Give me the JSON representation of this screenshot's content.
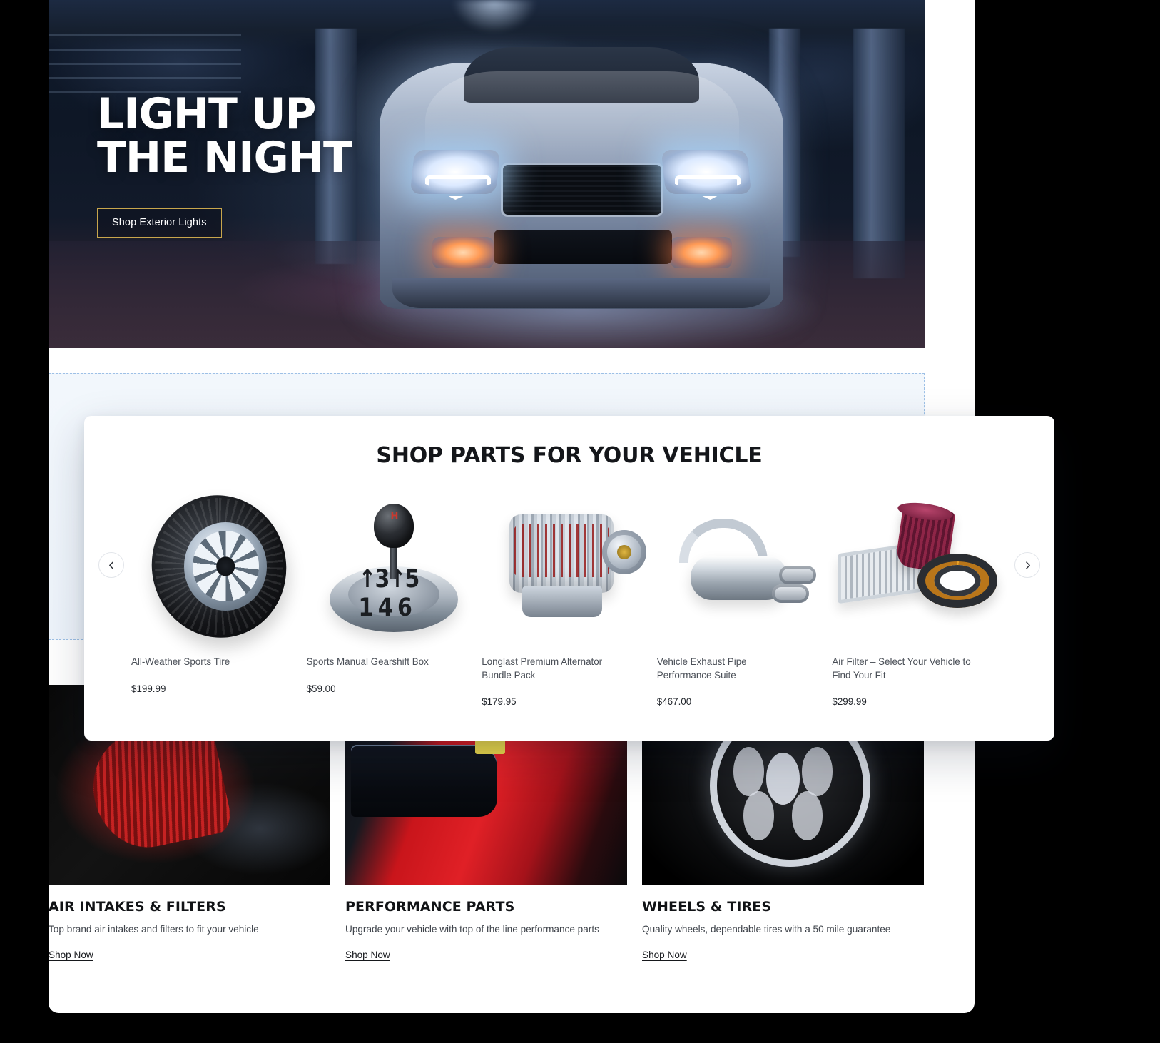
{
  "hero": {
    "title": "LIGHT UP\nTHE NIGHT",
    "cta_label": "Shop Exterior Lights",
    "cta_border_color": "#c8a64c"
  },
  "carousel_panel": {
    "title": "SHOP PARTS FOR YOUR VEHICLE",
    "prev_label": "‹",
    "next_label": "›",
    "products": [
      {
        "name": "All-Weather Sports Tire",
        "price": "$199.99",
        "image": "tire-image"
      },
      {
        "name": "Sports Manual Gearshift Box",
        "price": "$59.00",
        "image": "gearshift-image"
      },
      {
        "name": "Longlast Premium Alternator Bundle Pack",
        "price": "$179.95",
        "image": "alternator-image"
      },
      {
        "name": "Vehicle Exhaust Pipe Performance Suite",
        "price": "$467.00",
        "image": "exhaust-image"
      },
      {
        "name": "Air Filter – Select Your Vehicle to Find Your Fit",
        "price": "$299.99",
        "image": "air-filter-image"
      }
    ]
  },
  "categories": [
    {
      "title": "AIR INTAKES & FILTERS",
      "description": "Top brand air intakes and filters to fit your vehicle",
      "link_label": "Shop Now",
      "image": "air-intake-photo"
    },
    {
      "title": "PERFORMANCE PARTS",
      "description": "Upgrade your vehicle with top of the line performance parts",
      "link_label": "Shop Now",
      "image": "performance-parts-photo"
    },
    {
      "title": "WHEELS & TIRES",
      "description": "Quality wheels, dependable tires with a 50 mile guarantee",
      "link_label": "Shop Now",
      "image": "wheels-tires-photo"
    }
  ],
  "gearshift_pattern": "↑3↑5\n1 4 6",
  "colors": {
    "page_background": "#000000",
    "canvas": "#ffffff",
    "dropzone_border": "#9dc0e6",
    "dropzone_fill": "#f2f7fc",
    "heading": "#14161a",
    "body_text": "#4a4f57"
  }
}
